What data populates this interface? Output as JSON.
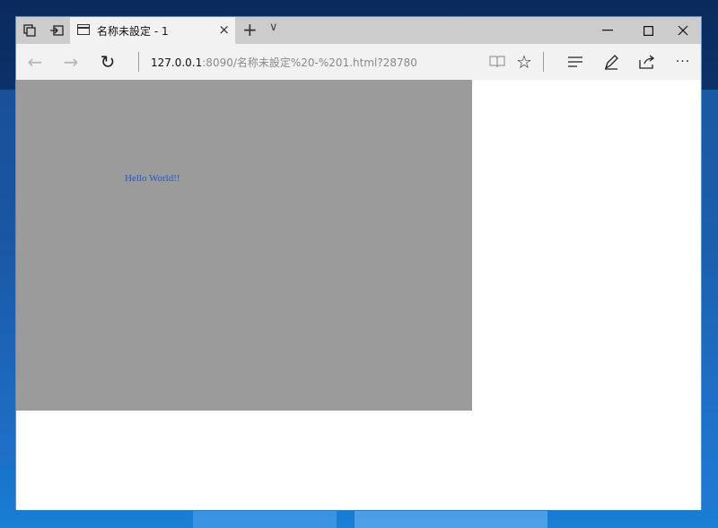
{
  "browser": {
    "tab": {
      "title": "名称未設定 - 1"
    },
    "address": {
      "host": "127.0.0.1",
      "rest": ":8090/名称未設定%20-%201.html?28780"
    }
  },
  "page": {
    "text": "Hello World!!",
    "box_color": "#9b9b9b",
    "text_color": "#2255cc"
  },
  "icons": {
    "tab_close": "×",
    "new_tab": "+",
    "tab_list": "∨",
    "minimize": "—",
    "maximize": "☐",
    "close": "✕",
    "back": "←",
    "forward": "→",
    "refresh": "↻",
    "favorite": "☆",
    "more": "···"
  }
}
